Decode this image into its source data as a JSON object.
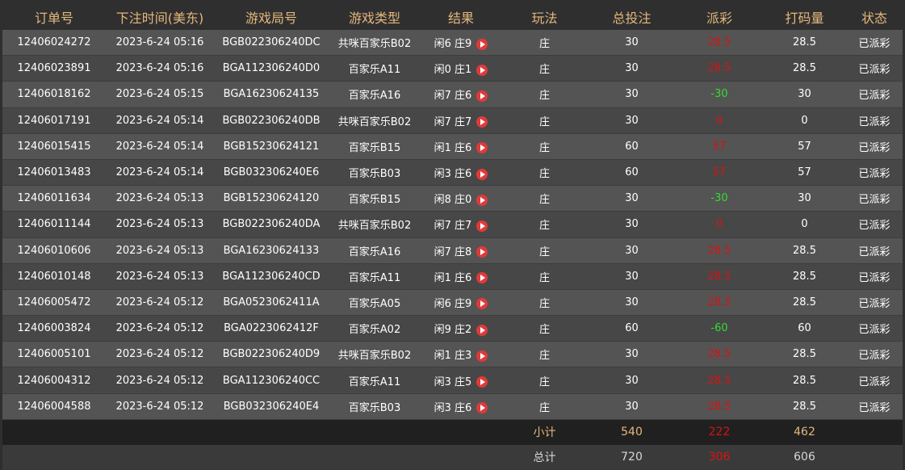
{
  "headers": [
    "订单号",
    "下注时间(美东)",
    "游戏局号",
    "游戏类型",
    "结果",
    "玩法",
    "总投注",
    "派彩",
    "打码量",
    "状态"
  ],
  "rows": [
    {
      "order": "12406024272",
      "time": "2023-6-24 05:16",
      "round": "BGB022306240DC",
      "type": "共咪百家乐B02",
      "result": "闲6 庄9",
      "play": "庄",
      "bet": "30",
      "payout": "28.5",
      "payout_sign": "pos",
      "code": "28.5",
      "status": "已派彩"
    },
    {
      "order": "12406023891",
      "time": "2023-6-24 05:16",
      "round": "BGA112306240D0",
      "type": "百家乐A11",
      "result": "闲0 庄1",
      "play": "庄",
      "bet": "30",
      "payout": "28.5",
      "payout_sign": "pos",
      "code": "28.5",
      "status": "已派彩"
    },
    {
      "order": "12406018162",
      "time": "2023-6-24 05:15",
      "round": "BGA16230624135",
      "type": "百家乐A16",
      "result": "闲7 庄6",
      "play": "庄",
      "bet": "30",
      "payout": "-30",
      "payout_sign": "neg",
      "code": "30",
      "status": "已派彩"
    },
    {
      "order": "12406017191",
      "time": "2023-6-24 05:14",
      "round": "BGB022306240DB",
      "type": "共咪百家乐B02",
      "result": "闲7 庄7",
      "play": "庄",
      "bet": "30",
      "payout": "0",
      "payout_sign": "pos",
      "code": "0",
      "status": "已派彩"
    },
    {
      "order": "12406015415",
      "time": "2023-6-24 05:14",
      "round": "BGB15230624121",
      "type": "百家乐B15",
      "result": "闲1 庄6",
      "play": "庄",
      "bet": "60",
      "payout": "57",
      "payout_sign": "pos",
      "code": "57",
      "status": "已派彩"
    },
    {
      "order": "12406013483",
      "time": "2023-6-24 05:14",
      "round": "BGB032306240E6",
      "type": "百家乐B03",
      "result": "闲3 庄6",
      "play": "庄",
      "bet": "60",
      "payout": "57",
      "payout_sign": "pos",
      "code": "57",
      "status": "已派彩"
    },
    {
      "order": "12406011634",
      "time": "2023-6-24 05:13",
      "round": "BGB15230624120",
      "type": "百家乐B15",
      "result": "闲8 庄0",
      "play": "庄",
      "bet": "30",
      "payout": "-30",
      "payout_sign": "neg",
      "code": "30",
      "status": "已派彩"
    },
    {
      "order": "12406011144",
      "time": "2023-6-24 05:13",
      "round": "BGB022306240DA",
      "type": "共咪百家乐B02",
      "result": "闲7 庄7",
      "play": "庄",
      "bet": "30",
      "payout": "0",
      "payout_sign": "pos",
      "code": "0",
      "status": "已派彩"
    },
    {
      "order": "12406010606",
      "time": "2023-6-24 05:13",
      "round": "BGA16230624133",
      "type": "百家乐A16",
      "result": "闲7 庄8",
      "play": "庄",
      "bet": "30",
      "payout": "28.5",
      "payout_sign": "pos",
      "code": "28.5",
      "status": "已派彩"
    },
    {
      "order": "12406010148",
      "time": "2023-6-24 05:13",
      "round": "BGA112306240CD",
      "type": "百家乐A11",
      "result": "闲1 庄6",
      "play": "庄",
      "bet": "30",
      "payout": "28.5",
      "payout_sign": "pos",
      "code": "28.5",
      "status": "已派彩"
    },
    {
      "order": "12406005472",
      "time": "2023-6-24 05:12",
      "round": "BGA0523062411A",
      "type": "百家乐A05",
      "result": "闲6 庄9",
      "play": "庄",
      "bet": "30",
      "payout": "28.5",
      "payout_sign": "pos",
      "code": "28.5",
      "status": "已派彩"
    },
    {
      "order": "12406003824",
      "time": "2023-6-24 05:12",
      "round": "BGA0223062412F",
      "type": "百家乐A02",
      "result": "闲9 庄2",
      "play": "庄",
      "bet": "60",
      "payout": "-60",
      "payout_sign": "neg",
      "code": "60",
      "status": "已派彩"
    },
    {
      "order": "12406005101",
      "time": "2023-6-24 05:12",
      "round": "BGB022306240D9",
      "type": "共咪百家乐B02",
      "result": "闲1 庄3",
      "play": "庄",
      "bet": "30",
      "payout": "28.5",
      "payout_sign": "pos",
      "code": "28.5",
      "status": "已派彩"
    },
    {
      "order": "12406004312",
      "time": "2023-6-24 05:12",
      "round": "BGA112306240CC",
      "type": "百家乐A11",
      "result": "闲3 庄5",
      "play": "庄",
      "bet": "30",
      "payout": "28.5",
      "payout_sign": "pos",
      "code": "28.5",
      "status": "已派彩"
    },
    {
      "order": "12406004588",
      "time": "2023-6-24 05:12",
      "round": "BGB032306240E4",
      "type": "百家乐B03",
      "result": "闲3 庄6",
      "play": "庄",
      "bet": "30",
      "payout": "28.5",
      "payout_sign": "pos",
      "code": "28.5",
      "status": "已派彩"
    }
  ],
  "subtotal": {
    "label": "小计",
    "bet": "540",
    "payout": "222",
    "code": "462"
  },
  "total": {
    "label": "总计",
    "bet": "720",
    "payout": "306",
    "code": "606"
  },
  "colors": {
    "header": "#e4b77c",
    "payout_positive": "#dd1111",
    "payout_negative": "#33dd33",
    "play_icon": "#e03a3a"
  },
  "icons": {
    "result_replay": "play-circle-icon"
  }
}
